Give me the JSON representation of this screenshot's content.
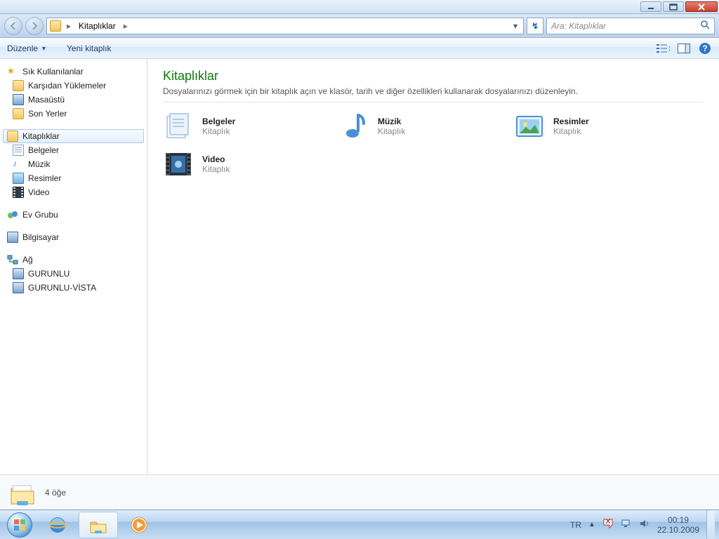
{
  "window_controls": {
    "minimize": "–",
    "maximize": "❐",
    "close": "✕"
  },
  "nav": {
    "location_root": "Kitaplıklar",
    "refresh_glyph": "↯",
    "search_placeholder": "Ara: Kitaplıklar"
  },
  "toolbar": {
    "organize": "Düzenle",
    "new_library": "Yeni kitaplık"
  },
  "sidebar": {
    "favorites": {
      "header": "Sık Kullanılanlar",
      "items": [
        "Karşıdan Yüklemeler",
        "Masaüstü",
        "Son Yerler"
      ]
    },
    "libraries": {
      "header": "Kitaplıklar",
      "items": [
        "Belgeler",
        "Müzik",
        "Resimler",
        "Video"
      ]
    },
    "homegroup": "Ev Grubu",
    "computer": "Bilgisayar",
    "network": {
      "header": "Ağ",
      "items": [
        "GURUNLU",
        "GURUNLU-VİSTA"
      ]
    }
  },
  "content": {
    "title": "Kitaplıklar",
    "description": "Dosyalarınızı görmek için bir kitaplık açın ve klasör, tarih ve diğer özellikleri kullanarak dosyalarınızı düzenleyin.",
    "lib_sub": "Kitaplık",
    "libs": [
      {
        "name": "Belgeler",
        "icon": "documents"
      },
      {
        "name": "Müzik",
        "icon": "music"
      },
      {
        "name": "Resimler",
        "icon": "pictures"
      },
      {
        "name": "Video",
        "icon": "videos"
      }
    ]
  },
  "details": {
    "count_text": "4 öğe"
  },
  "taskbar": {
    "lang": "TR",
    "time": "00:19",
    "date": "22.10.2009"
  }
}
